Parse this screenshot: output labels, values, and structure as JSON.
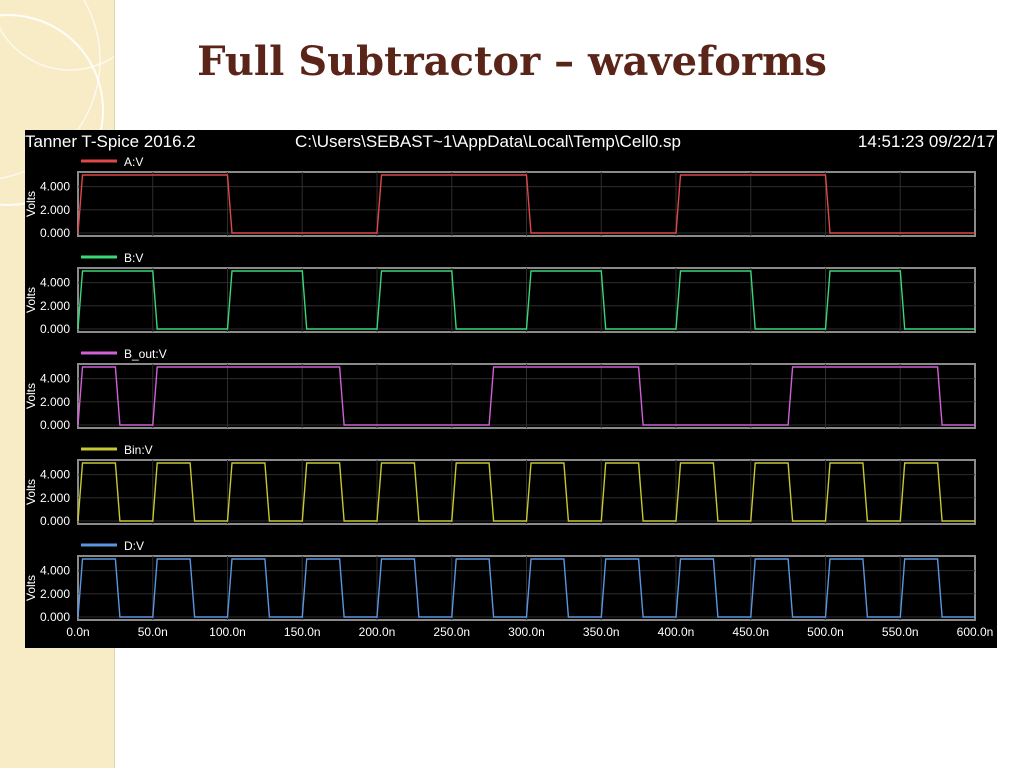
{
  "slide": {
    "title": "Full Subtractor – waveforms"
  },
  "window": {
    "app": "Tanner T-Spice 2016.2",
    "path": "C:\\Users\\SEBAST~1\\AppData\\Local\\Temp\\Cell0.sp",
    "timestamp": "14:51:23 09/22/17"
  },
  "chart_data": {
    "type": "line",
    "xlabel": "",
    "ylabel": "Volts",
    "xlim": [
      0,
      600
    ],
    "ylim": [
      0,
      5
    ],
    "x_unit": "n",
    "x_ticks": [
      "0.0n",
      "50.0n",
      "100.0n",
      "150.0n",
      "200.0n",
      "250.0n",
      "300.0n",
      "350.0n",
      "400.0n",
      "450.0n",
      "500.0n",
      "550.0n",
      "600.0n"
    ],
    "y_ticks": [
      "0.000",
      "2.000",
      "4.000"
    ],
    "grid": true,
    "series": [
      {
        "name": "A:V",
        "color": "#e04848",
        "x": [
          0,
          3,
          100,
          103,
          200,
          203,
          300,
          303,
          400,
          403,
          500,
          503,
          600
        ],
        "y": [
          0,
          5,
          5,
          0,
          0,
          5,
          5,
          0,
          0,
          5,
          5,
          0,
          0
        ]
      },
      {
        "name": "B:V",
        "color": "#38d878",
        "x": [
          0,
          3,
          50,
          53,
          100,
          103,
          150,
          153,
          200,
          203,
          250,
          253,
          300,
          303,
          350,
          353,
          400,
          403,
          450,
          453,
          500,
          503,
          550,
          553,
          600
        ],
        "y": [
          0,
          5,
          5,
          0,
          0,
          5,
          5,
          0,
          0,
          5,
          5,
          0,
          0,
          5,
          5,
          0,
          0,
          5,
          5,
          0,
          0,
          5,
          5,
          0,
          0
        ]
      },
      {
        "name": "B_out:V",
        "color": "#d060d8",
        "x": [
          0,
          3,
          25,
          28,
          50,
          53,
          75,
          78,
          100,
          103,
          150,
          153,
          175,
          178,
          200,
          203,
          250,
          253,
          275,
          278,
          300,
          303,
          350,
          353,
          375,
          378,
          400,
          403,
          450,
          453,
          475,
          478,
          500,
          503,
          550,
          553,
          575,
          578,
          600
        ],
        "y": [
          0,
          5,
          5,
          0,
          0,
          5,
          5,
          5,
          5,
          5,
          5,
          5,
          5,
          0,
          0,
          0,
          0,
          0,
          0,
          5,
          5,
          5,
          5,
          5,
          5,
          0,
          0,
          0,
          0,
          0,
          0,
          5,
          5,
          5,
          5,
          5,
          5,
          0,
          0
        ]
      },
      {
        "name": "Bin:V",
        "color": "#c8c832",
        "x": [
          0,
          3,
          25,
          28,
          50,
          53,
          75,
          78,
          100,
          103,
          125,
          128,
          150,
          153,
          175,
          178,
          200,
          203,
          225,
          228,
          250,
          253,
          275,
          278,
          300,
          303,
          325,
          328,
          350,
          353,
          375,
          378,
          400,
          403,
          425,
          428,
          450,
          453,
          475,
          478,
          500,
          503,
          525,
          528,
          550,
          553,
          575,
          578,
          600
        ],
        "y": [
          0,
          5,
          5,
          0,
          0,
          5,
          5,
          0,
          0,
          5,
          5,
          0,
          0,
          5,
          5,
          0,
          0,
          5,
          5,
          0,
          0,
          5,
          5,
          0,
          0,
          5,
          5,
          0,
          0,
          5,
          5,
          0,
          0,
          5,
          5,
          0,
          0,
          5,
          5,
          0,
          0,
          5,
          5,
          0,
          0,
          5,
          5,
          0,
          0
        ]
      },
      {
        "name": "D:V",
        "color": "#5a96e0",
        "x": [
          0,
          3,
          25,
          28,
          50,
          53,
          75,
          78,
          100,
          103,
          125,
          128,
          150,
          153,
          175,
          178,
          200,
          203,
          225,
          228,
          250,
          253,
          275,
          278,
          300,
          303,
          325,
          328,
          350,
          353,
          375,
          378,
          400,
          403,
          425,
          428,
          450,
          453,
          475,
          478,
          500,
          503,
          525,
          528,
          550,
          553,
          575,
          578,
          600
        ],
        "y": [
          0,
          5,
          5,
          0,
          0,
          5,
          5,
          0,
          0,
          5,
          5,
          0,
          0,
          5,
          5,
          0,
          0,
          5,
          5,
          0,
          0,
          5,
          5,
          0,
          0,
          5,
          5,
          0,
          0,
          5,
          5,
          0,
          0,
          5,
          5,
          0,
          0,
          5,
          5,
          0,
          0,
          5,
          5,
          0,
          0,
          5,
          5,
          0,
          0
        ]
      }
    ]
  }
}
